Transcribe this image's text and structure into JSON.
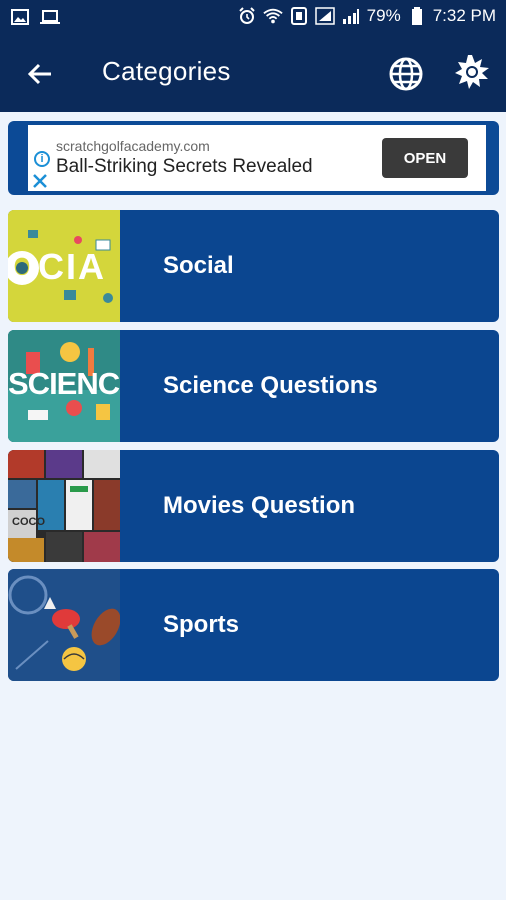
{
  "statusbar": {
    "battery": "79%",
    "time": "7:32 PM"
  },
  "appbar": {
    "title": "Categories"
  },
  "ad": {
    "domain": "scratchgolfacademy.com",
    "headline": "Ball-Striking Secrets Revealed",
    "cta": "OPEN"
  },
  "categories": [
    {
      "label": "Social",
      "thumb_text": "OCIA"
    },
    {
      "label": "Science Questions",
      "thumb_text": "SCIENCE"
    },
    {
      "label": "Movies Question",
      "thumb_text": "COCO"
    },
    {
      "label": "Sports"
    }
  ],
  "colors": {
    "bar": "#0b2a5a",
    "card": "#0b4690",
    "background": "#eef4fc"
  }
}
